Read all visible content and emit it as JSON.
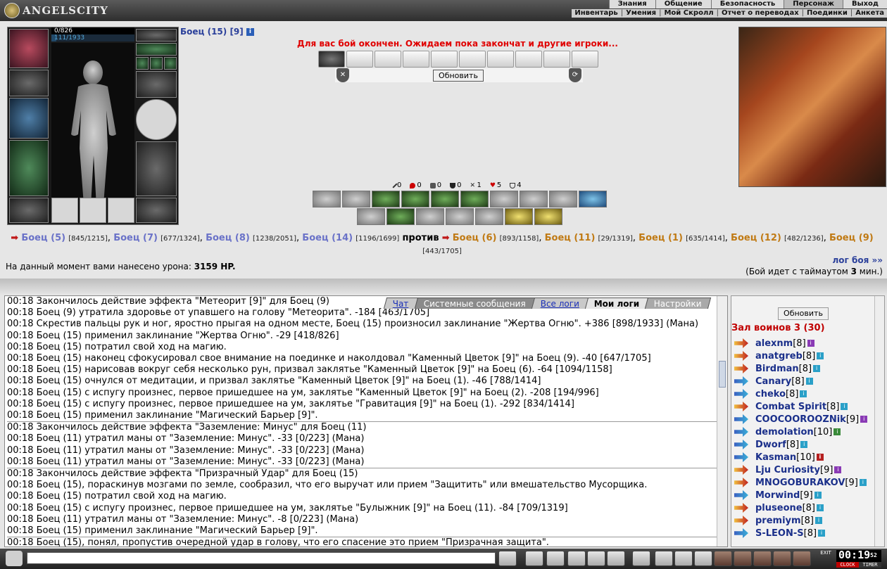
{
  "app": {
    "logo_text": "ANGELSCITY"
  },
  "menu_top": [
    "Знания",
    "Общение",
    "Безопасность",
    "Персонаж",
    "Выход"
  ],
  "menu_sub": [
    "Инвентарь",
    "Умения",
    "Мой Скролл",
    "Отчет о переводах",
    "Поединки",
    "Анкета"
  ],
  "character": {
    "title": "Боец (15) [9]",
    "hp_text": "0/826",
    "mp_text": "111/1933",
    "hp_fraction": 0,
    "mp_fraction": 0.057
  },
  "battle": {
    "message": "Для вас бой окончен. Ожидаем пока закончат и другие игроки...",
    "refresh_label": "Обновить",
    "stats": [
      "0",
      "0",
      "0",
      "0",
      "1",
      "5",
      "4"
    ],
    "team_vs": "против",
    "damage_label": "На данный момент вами нанесено урона:",
    "damage_value": "3159 HP.",
    "log_link": "лог боя »»",
    "timeout_prefix": "(Бой идет с таймаутом",
    "timeout_value": "3",
    "timeout_suffix": "мин.)"
  },
  "team_blue": [
    {
      "name": "Боец (5)",
      "hp": "[845/1215]"
    },
    {
      "name": "Боец (7)",
      "hp": "[677/1324]"
    },
    {
      "name": "Боец (8)",
      "hp": "[1238/2051]"
    },
    {
      "name": "Боец (14)",
      "hp": "[1196/1699]"
    }
  ],
  "team_orange": [
    {
      "name": "Боец (6)",
      "hp": "[893/1158]"
    },
    {
      "name": "Боец (11)",
      "hp": "[29/1319]"
    },
    {
      "name": "Боец (1)",
      "hp": "[635/1414]"
    },
    {
      "name": "Боец (12)",
      "hp": "[482/1236]"
    },
    {
      "name": "Боец (9)",
      "hp": "[443/1705]"
    }
  ],
  "chat_tabs": [
    "Чат",
    "Системные сообщения",
    "Все логи",
    "Мои логи",
    "Настройки"
  ],
  "chat_lines": [
    "00:18 Закончилось действие эффекта \"Метеорит [9]\" для Боец (9)",
    "00:18 Боец (9) утратила здоровье от упавшего на голову \"Метеорита\". -184 [463/1705]",
    "00:18 Скрестив пальцы рук и ног, яростно прыгая на одном месте, Боец (15) произносил заклинание \"Жертва Огню\". +386 [898/1933] (Мана)",
    "00:18 Боец (15) применил заклинание \"Жертва Огню\". -29 [418/826]",
    "00:18 Боец (15) потратил свой ход на магию.",
    "00:18 Боец (15) наконец сфокусировал свое внимание на поединке и наколдовал \"Каменный Цветок [9]\" на Боец (9). -40 [647/1705]",
    "00:18 Боец (15) нарисовав вокруг себя несколько рун, призвал заклятье \"Каменный Цветок [9]\" на Боец (6). -64 [1094/1158]",
    "00:18 Боец (15) очнулся от медитации, и призвал заклятье \"Каменный Цветок [9]\" на Боец (1). -46 [788/1414]",
    "00:18 Боец (15) с испугу произнес, первое пришедшее на ум, заклятье \"Каменный Цветок [9]\" на Боец (2). -208 [194/996]",
    "00:18 Боец (15) с испугу произнес, первое пришедшее на ум, заклятье \"Гравитация [9]\" на Боец (1). -292 [834/1414]",
    "00:18 Боец (15) применил заклинание \"Магический Барьер [9]\".",
    "00:18 Закончилось действие эффекта \"Заземление: Минус\" для Боец (11)",
    "00:18 Боец (11) утратил маны от \"Заземление: Минус\". -33 [0/223] (Мана)",
    "00:18 Боец (11) утратил маны от \"Заземление: Минус\". -33 [0/223] (Мана)",
    "00:18 Боец (11) утратил маны от \"Заземление: Минус\". -33 [0/223] (Мана)",
    "00:18 Закончилось действие эффекта \"Призрачный Удар\" для Боец (15)",
    "00:18 Боец (15), пораскинув мозгами по земле, сообразил, что его выручат или прием \"Защитить\" или вмешательство Мусорщика.",
    "00:18 Боец (15) потратил свой ход на магию.",
    "00:18 Боец (15) с испугу произнес, первое пришедшее на ум, заклятье \"Булыжник [9]\" на Боец (11). -84 [709/1319]",
    "00:18 Боец (11) утратил маны от \"Заземление: Минус\". -8 [0/223] (Мана)",
    "00:18 Боец (15) применил заклинание \"Магический Барьер [9]\".",
    "00:18 Боец (15), понял, пропустив очередной удар в голову, что его спасение это прием \"Призрачная защита\"."
  ],
  "side": {
    "refresh_label": "Обновить",
    "title": "Зал воинов 3 (30)",
    "players": [
      {
        "name": "alexnm",
        "level": "[8]",
        "badge": "p",
        "icon": "o"
      },
      {
        "name": "anatgreb",
        "level": "[8]",
        "badge": "c",
        "icon": "o"
      },
      {
        "name": "Birdman",
        "level": "[8]",
        "badge": "c",
        "icon": "o"
      },
      {
        "name": "Canary",
        "level": "[8]",
        "badge": "c",
        "icon": "b"
      },
      {
        "name": "cheko",
        "level": "[8]",
        "badge": "c",
        "icon": "b"
      },
      {
        "name": "Combat Spirit",
        "level": "[8]",
        "badge": "c",
        "icon": "o"
      },
      {
        "name": "COOCOOROOZNik",
        "level": "[9]",
        "badge": "p",
        "icon": "b"
      },
      {
        "name": "demolation",
        "level": "[10]",
        "badge": "g",
        "icon": "b"
      },
      {
        "name": "Dworf",
        "level": "[8]",
        "badge": "c",
        "icon": "b"
      },
      {
        "name": "Kasman",
        "level": "[10]",
        "badge": "r",
        "icon": "b"
      },
      {
        "name": "Lju Curiosity",
        "level": "[9]",
        "badge": "p",
        "icon": "o"
      },
      {
        "name": "MNOGOBURAKOV",
        "level": "[9]",
        "badge": "c",
        "icon": "o"
      },
      {
        "name": "Morwind",
        "level": "[9]",
        "badge": "c",
        "icon": "b"
      },
      {
        "name": "pluseone",
        "level": "[8]",
        "badge": "c",
        "icon": "o"
      },
      {
        "name": "premiym",
        "level": "[8]",
        "badge": "c",
        "icon": "o"
      },
      {
        "name": "S-LEON-S",
        "level": "[8]",
        "badge": "c",
        "icon": "b"
      }
    ]
  },
  "clock": {
    "time": "00:19",
    "seconds": "52",
    "label_clock": "CLOCK",
    "label_timer": "TIMER"
  },
  "exit_label": "EXIT"
}
